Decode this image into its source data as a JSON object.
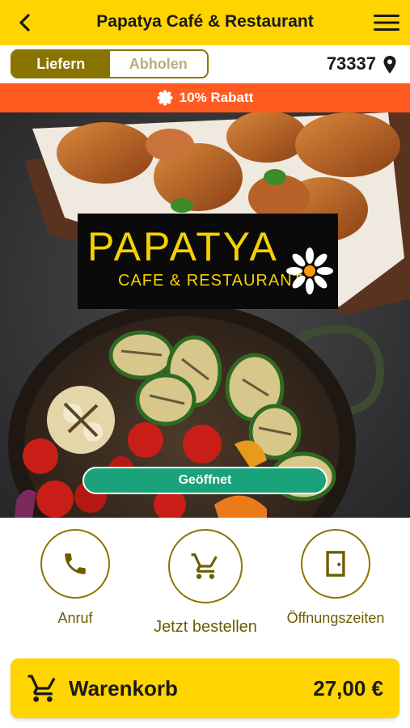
{
  "header": {
    "title": "Papatya Café & Restaurant",
    "back_icon": "chevron-left-icon",
    "menu_icon": "hamburger-menu-icon"
  },
  "mode_toggle": {
    "options": [
      "Liefern",
      "Abholen"
    ],
    "selected": "Liefern"
  },
  "location": {
    "zip": "73337",
    "icon": "map-pin-icon"
  },
  "discount_banner": {
    "text": "10% Rabatt",
    "icon": "badge-icon",
    "color": "#ff5a1f"
  },
  "restaurant": {
    "logo_text": "PAPATYA",
    "logo_subtitle": "CAFE & RESTAURANT",
    "status": "Geöffnet",
    "status_color": "#1aa37a"
  },
  "actions": [
    {
      "label": "Anruf",
      "icon": "phone-icon"
    },
    {
      "label": "Jetzt bestellen",
      "icon": "shopping-cart-icon"
    },
    {
      "label": "Öffnungszeiten",
      "icon": "door-icon"
    }
  ],
  "cart": {
    "label": "Warenkorb",
    "total": "27,00 €",
    "icon": "shopping-cart-icon"
  },
  "colors": {
    "brand_yellow": "#ffd400",
    "accent_olive": "#8a7400"
  }
}
